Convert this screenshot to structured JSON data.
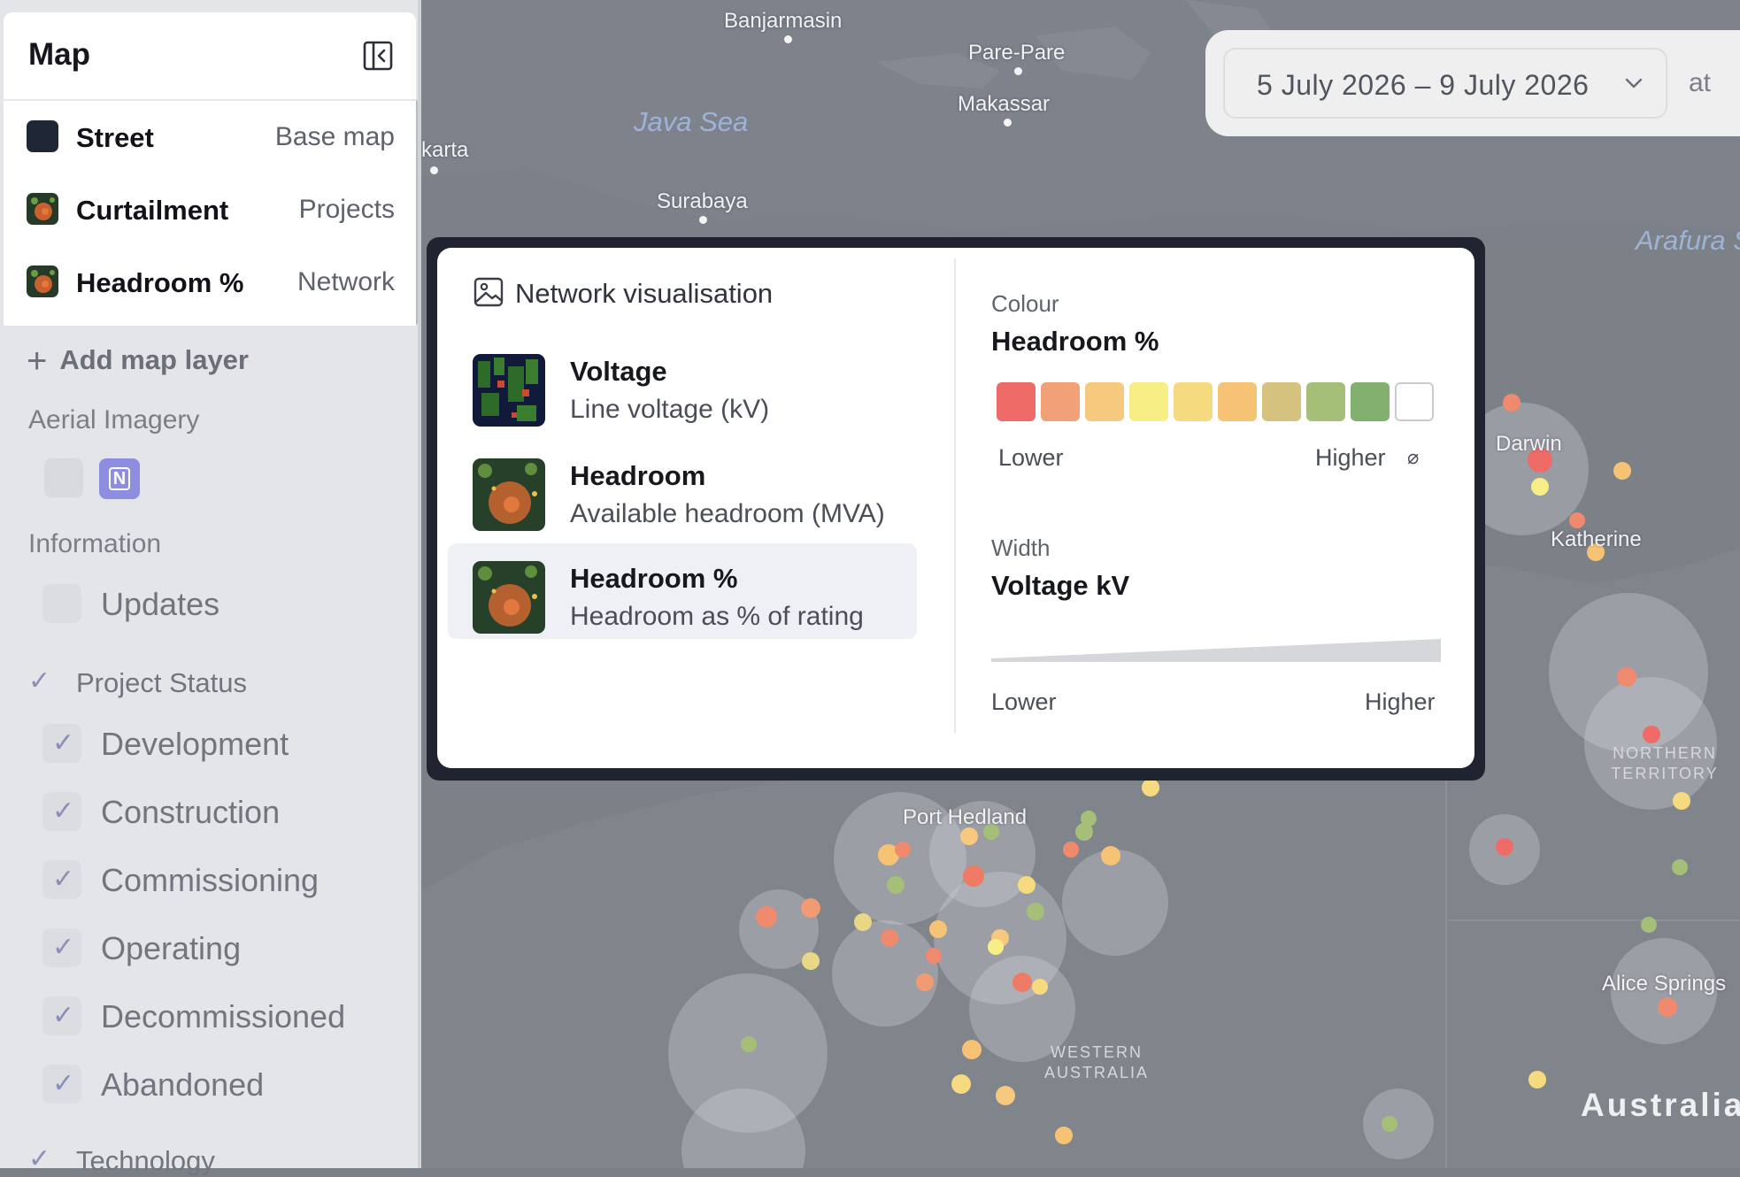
{
  "sidebar": {
    "title": "Map",
    "layers": [
      {
        "name": "Street",
        "type": "Base map"
      },
      {
        "name": "Curtailment",
        "type": "Projects"
      },
      {
        "name": "Headroom %",
        "type": "Network"
      }
    ],
    "add_layer": "Add map layer",
    "aerial_label": "Aerial Imagery",
    "aerial_tile_letter": "N",
    "information_label": "Information",
    "information_items": [
      {
        "label": "Updates",
        "checked": false
      }
    ],
    "project_status_label": "Project Status",
    "project_status_items": [
      {
        "label": "Development",
        "checked": true
      },
      {
        "label": "Construction",
        "checked": true
      },
      {
        "label": "Commissioning",
        "checked": true
      },
      {
        "label": "Operating",
        "checked": true
      },
      {
        "label": "Decommissioned",
        "checked": true
      },
      {
        "label": "Abandoned",
        "checked": true
      }
    ],
    "technology_label": "Technology",
    "check_glyph": "✓"
  },
  "datebar": {
    "range": "5 July 2026 – 9 July 2026",
    "at_label": "at"
  },
  "popup": {
    "title": "Network visualisation",
    "options": [
      {
        "name": "Voltage",
        "desc": "Line voltage (kV)",
        "selected": false
      },
      {
        "name": "Headroom",
        "desc": "Available headroom (MVA)",
        "selected": false
      },
      {
        "name": "Headroom %",
        "desc": "Headroom as % of rating",
        "selected": true
      }
    ],
    "colour_label": "Colour",
    "colour_value": "Headroom %",
    "colour_scale": [
      "#ef6b68",
      "#f1a078",
      "#f7c97f",
      "#f8ee86",
      "#f6da7f",
      "#f6c374",
      "#d4c27e",
      "#a5bf78",
      "#82b06e",
      "#ffffff"
    ],
    "colour_lower": "Lower",
    "colour_higher": "Higher",
    "null_glyph": "⌀",
    "width_label": "Width",
    "width_value": "Voltage kV",
    "width_lower": "Lower",
    "width_higher": "Higher"
  },
  "map": {
    "cities": [
      "Banjarmasin",
      "Pare-Pare",
      "Makassar",
      "karta",
      "Surabaya",
      "Port Hedland",
      "Darwin",
      "Katherine",
      "Alice Springs"
    ],
    "seas": [
      "Java Sea",
      "Arafura S"
    ],
    "regions": [
      "WESTERN AUSTRALIA",
      "NORTHERN TERRITORY"
    ],
    "country": "Australia"
  }
}
